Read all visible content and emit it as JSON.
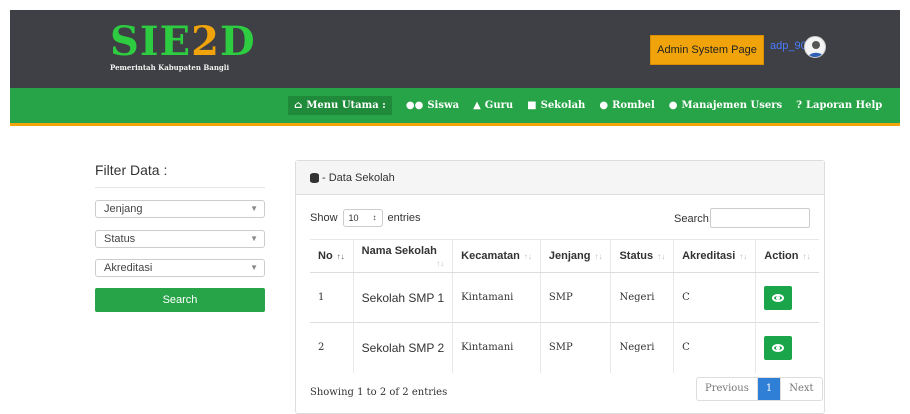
{
  "header": {
    "logo_text": "SIE2D",
    "logo_subtitle": "Pemerintah Kabupaten Bangli",
    "admin_button": "Admin System Page",
    "username": "adp_90"
  },
  "menu": {
    "items": [
      {
        "label": "Menu Utama :",
        "icon": "home-icon"
      },
      {
        "label": "Siswa",
        "icon": "users-icon"
      },
      {
        "label": "Guru",
        "icon": "graduation-cap-icon"
      },
      {
        "label": "Sekolah",
        "icon": "school-icon"
      },
      {
        "label": "Rombel",
        "icon": "group-icon"
      },
      {
        "label": "Manajemen Users",
        "icon": "users-cog-icon"
      },
      {
        "label": "Laporan Help",
        "icon": "question-icon"
      }
    ]
  },
  "filter": {
    "title": "Filter Data :",
    "selects": [
      "Jenjang",
      "Status",
      "Akreditasi"
    ],
    "search_button": "Search"
  },
  "panel": {
    "title": "- Data Sekolah",
    "show_label": "Show",
    "entries_label": "entries",
    "page_length": "10",
    "search_label": "Search:",
    "columns": [
      "No",
      "Nama Sekolah",
      "Kecamatan",
      "Jenjang",
      "Status",
      "Akreditasi",
      "Action"
    ],
    "rows": [
      {
        "no": "1",
        "nama": "Sekolah SMP 1",
        "kecamatan": "Kintamani",
        "jenjang": "SMP",
        "status": "Negeri",
        "akreditasi": "C"
      },
      {
        "no": "2",
        "nama": "Sekolah SMP 2",
        "kecamatan": "Kintamani",
        "jenjang": "SMP",
        "status": "Negeri",
        "akreditasi": "C"
      }
    ],
    "info": "Showing 1 to 2 of 2 entries",
    "pagination": {
      "previous": "Previous",
      "current": "1",
      "next": "Next"
    }
  },
  "colors": {
    "topbar": "#3e4045",
    "menubar": "#27a447",
    "accent": "#f0a30a",
    "logo_green": "#2ecc40",
    "link": "#4a7cff"
  }
}
